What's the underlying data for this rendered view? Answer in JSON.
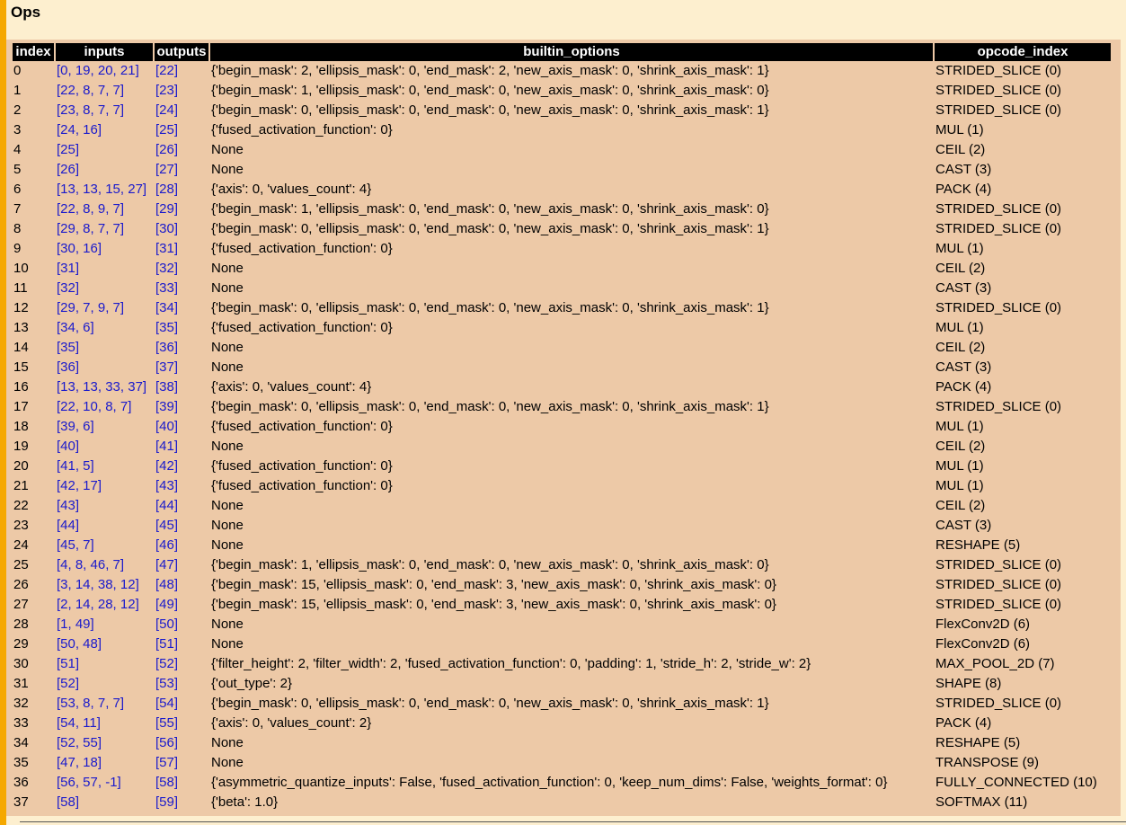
{
  "page": {
    "title": "Ops"
  },
  "table": {
    "columns": [
      "index",
      "inputs",
      "outputs",
      "builtin_options",
      "opcode_index"
    ],
    "rows": [
      [
        "0",
        "[0, 19, 20, 21]",
        "[22]",
        "{'begin_mask': 2, 'ellipsis_mask': 0, 'end_mask': 2, 'new_axis_mask': 0, 'shrink_axis_mask': 1}",
        "STRIDED_SLICE (0)"
      ],
      [
        "1",
        "[22, 8, 7, 7]",
        "[23]",
        "{'begin_mask': 1, 'ellipsis_mask': 0, 'end_mask': 0, 'new_axis_mask': 0, 'shrink_axis_mask': 0}",
        "STRIDED_SLICE (0)"
      ],
      [
        "2",
        "[23, 8, 7, 7]",
        "[24]",
        "{'begin_mask': 0, 'ellipsis_mask': 0, 'end_mask': 0, 'new_axis_mask': 0, 'shrink_axis_mask': 1}",
        "STRIDED_SLICE (0)"
      ],
      [
        "3",
        "[24, 16]",
        "[25]",
        "{'fused_activation_function': 0}",
        "MUL (1)"
      ],
      [
        "4",
        "[25]",
        "[26]",
        "None",
        "CEIL (2)"
      ],
      [
        "5",
        "[26]",
        "[27]",
        "None",
        "CAST (3)"
      ],
      [
        "6",
        "[13, 13, 15, 27]",
        "[28]",
        "{'axis': 0, 'values_count': 4}",
        "PACK (4)"
      ],
      [
        "7",
        "[22, 8, 9, 7]",
        "[29]",
        "{'begin_mask': 1, 'ellipsis_mask': 0, 'end_mask': 0, 'new_axis_mask': 0, 'shrink_axis_mask': 0}",
        "STRIDED_SLICE (0)"
      ],
      [
        "8",
        "[29, 8, 7, 7]",
        "[30]",
        "{'begin_mask': 0, 'ellipsis_mask': 0, 'end_mask': 0, 'new_axis_mask': 0, 'shrink_axis_mask': 1}",
        "STRIDED_SLICE (0)"
      ],
      [
        "9",
        "[30, 16]",
        "[31]",
        "{'fused_activation_function': 0}",
        "MUL (1)"
      ],
      [
        "10",
        "[31]",
        "[32]",
        "None",
        "CEIL (2)"
      ],
      [
        "11",
        "[32]",
        "[33]",
        "None",
        "CAST (3)"
      ],
      [
        "12",
        "[29, 7, 9, 7]",
        "[34]",
        "{'begin_mask': 0, 'ellipsis_mask': 0, 'end_mask': 0, 'new_axis_mask': 0, 'shrink_axis_mask': 1}",
        "STRIDED_SLICE (0)"
      ],
      [
        "13",
        "[34, 6]",
        "[35]",
        "{'fused_activation_function': 0}",
        "MUL (1)"
      ],
      [
        "14",
        "[35]",
        "[36]",
        "None",
        "CEIL (2)"
      ],
      [
        "15",
        "[36]",
        "[37]",
        "None",
        "CAST (3)"
      ],
      [
        "16",
        "[13, 13, 33, 37]",
        "[38]",
        "{'axis': 0, 'values_count': 4}",
        "PACK (4)"
      ],
      [
        "17",
        "[22, 10, 8, 7]",
        "[39]",
        "{'begin_mask': 0, 'ellipsis_mask': 0, 'end_mask': 0, 'new_axis_mask': 0, 'shrink_axis_mask': 1}",
        "STRIDED_SLICE (0)"
      ],
      [
        "18",
        "[39, 6]",
        "[40]",
        "{'fused_activation_function': 0}",
        "MUL (1)"
      ],
      [
        "19",
        "[40]",
        "[41]",
        "None",
        "CEIL (2)"
      ],
      [
        "20",
        "[41, 5]",
        "[42]",
        "{'fused_activation_function': 0}",
        "MUL (1)"
      ],
      [
        "21",
        "[42, 17]",
        "[43]",
        "{'fused_activation_function': 0}",
        "MUL (1)"
      ],
      [
        "22",
        "[43]",
        "[44]",
        "None",
        "CEIL (2)"
      ],
      [
        "23",
        "[44]",
        "[45]",
        "None",
        "CAST (3)"
      ],
      [
        "24",
        "[45, 7]",
        "[46]",
        "None",
        "RESHAPE (5)"
      ],
      [
        "25",
        "[4, 8, 46, 7]",
        "[47]",
        "{'begin_mask': 1, 'ellipsis_mask': 0, 'end_mask': 0, 'new_axis_mask': 0, 'shrink_axis_mask': 0}",
        "STRIDED_SLICE (0)"
      ],
      [
        "26",
        "[3, 14, 38, 12]",
        "[48]",
        "{'begin_mask': 15, 'ellipsis_mask': 0, 'end_mask': 3, 'new_axis_mask': 0, 'shrink_axis_mask': 0}",
        "STRIDED_SLICE (0)"
      ],
      [
        "27",
        "[2, 14, 28, 12]",
        "[49]",
        "{'begin_mask': 15, 'ellipsis_mask': 0, 'end_mask': 3, 'new_axis_mask': 0, 'shrink_axis_mask': 0}",
        "STRIDED_SLICE (0)"
      ],
      [
        "28",
        "[1, 49]",
        "[50]",
        "None",
        "FlexConv2D (6)"
      ],
      [
        "29",
        "[50, 48]",
        "[51]",
        "None",
        "FlexConv2D (6)"
      ],
      [
        "30",
        "[51]",
        "[52]",
        "{'filter_height': 2, 'filter_width': 2, 'fused_activation_function': 0, 'padding': 1, 'stride_h': 2, 'stride_w': 2}",
        "MAX_POOL_2D (7)"
      ],
      [
        "31",
        "[52]",
        "[53]",
        "{'out_type': 2}",
        "SHAPE (8)"
      ],
      [
        "32",
        "[53, 8, 7, 7]",
        "[54]",
        "{'begin_mask': 0, 'ellipsis_mask': 0, 'end_mask': 0, 'new_axis_mask': 0, 'shrink_axis_mask': 1}",
        "STRIDED_SLICE (0)"
      ],
      [
        "33",
        "[54, 11]",
        "[55]",
        "{'axis': 0, 'values_count': 2}",
        "PACK (4)"
      ],
      [
        "34",
        "[52, 55]",
        "[56]",
        "None",
        "RESHAPE (5)"
      ],
      [
        "35",
        "[47, 18]",
        "[57]",
        "None",
        "TRANSPOSE (9)"
      ],
      [
        "36",
        "[56, 57, -1]",
        "[58]",
        "{'asymmetric_quantize_inputs': False, 'fused_activation_function': 0, 'keep_num_dims': False, 'weights_format': 0}",
        "FULLY_CONNECTED (10)"
      ],
      [
        "37",
        "[58]",
        "[59]",
        "{'beta': 1.0}",
        "SOFTMAX (11)"
      ]
    ]
  },
  "colors": {
    "page_background": "#fdefcf",
    "table_background": "#edc9a7",
    "header_background": "#000000",
    "link_text": "#1a1acc",
    "left_bar": "#f5a800"
  }
}
